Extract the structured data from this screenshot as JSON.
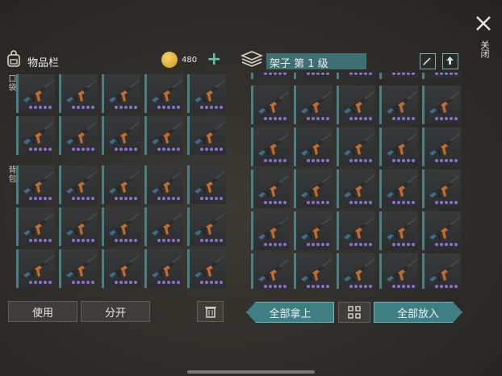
{
  "inventory": {
    "title": "物品栏",
    "coins": "480",
    "pocket_label": "口袋",
    "backpack_label": "背包",
    "use_label": "使用",
    "split_label": "分开"
  },
  "shelf": {
    "title": "架子 第 1 级",
    "take_all_label": "全部拿上",
    "put_all_label": "全部放入"
  },
  "close": {
    "label": "关闭"
  },
  "item": {
    "icon": "ak-rifle-icon",
    "rarity_dots": 5
  },
  "colors": {
    "accent": "#4b7f86",
    "rarity": "#8d6fd0",
    "coin": "#e0b53a",
    "plus": "#5fc3a8"
  }
}
